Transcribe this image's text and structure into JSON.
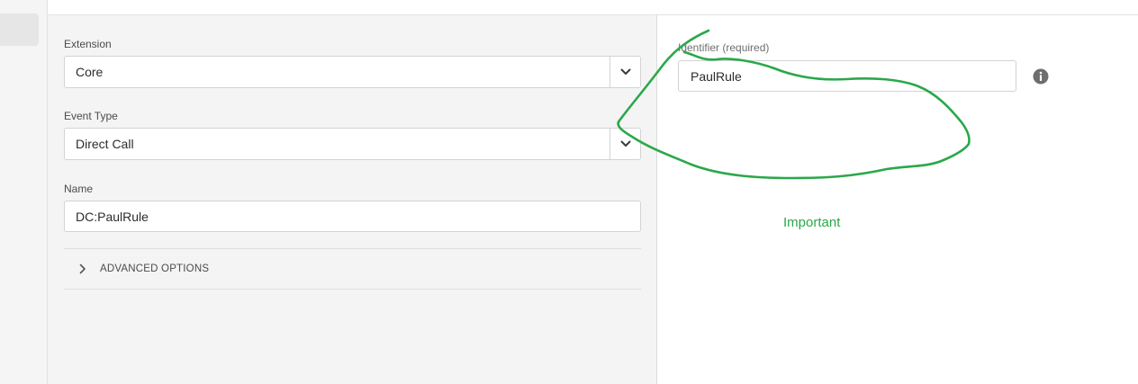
{
  "form": {
    "extension_label": "Extension",
    "extension_value": "Core",
    "event_type_label": "Event Type",
    "event_type_value": "Direct Call",
    "name_label": "Name",
    "name_value": "DC:PaulRule",
    "advanced_options_label": "ADVANCED OPTIONS"
  },
  "detail": {
    "identifier_label": "Identifier (required)",
    "identifier_value": "PaulRule"
  },
  "annotation": {
    "text": "Important",
    "color": "#2aa84a"
  },
  "icons": {
    "dropdown": "chevron-down-icon",
    "expand": "chevron-right-icon",
    "info": "info-icon"
  }
}
